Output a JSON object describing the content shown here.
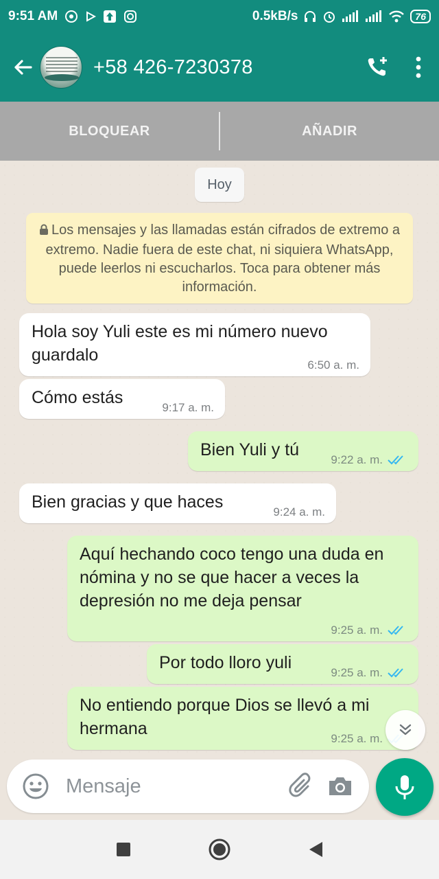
{
  "status_bar": {
    "time": "9:51 AM",
    "speed": "0.5kB/s",
    "battery": "76"
  },
  "header": {
    "contact": "+58 426-7230378",
    "icons": [
      "back-arrow-icon",
      "add-call-icon",
      "more-vert-icon"
    ],
    "color": "#128c7e"
  },
  "actions": {
    "block": "BLOQUEAR",
    "add": "AÑADIR"
  },
  "chat": {
    "date_chip": "Hoy",
    "encryption_notice": "Los mensajes y las llamadas están cifrados de extremo a extremo. Nadie fuera de este chat, ni siquiera WhatsApp, puede leerlos ni escucharlos. Toca para obtener más información.",
    "messages": [
      {
        "direction": "in",
        "text": "Hola soy Yuli este es mi número nuevo guardalo",
        "time": "6:50 a. m."
      },
      {
        "direction": "in",
        "text": "Cómo estás",
        "time": "9:17 a. m."
      },
      {
        "direction": "out",
        "text": "Bien Yuli y tú",
        "time": "9:22 a. m.",
        "read": true
      },
      {
        "direction": "in",
        "text": "Bien gracias y que haces",
        "time": "9:24 a. m."
      },
      {
        "direction": "out",
        "text": "Aquí hechando coco tengo una duda en nómina y no se que hacer a veces la depresión no me deja pensar",
        "time": "9:25 a. m.",
        "read": true
      },
      {
        "direction": "out",
        "text": "Por todo lloro yuli",
        "time": "9:25 a. m.",
        "read": true
      },
      {
        "direction": "out",
        "text": "No entiendo porque Dios se llevó a mi hermana",
        "time": "9:25 a. m.",
        "read": true
      }
    ]
  },
  "composer": {
    "placeholder": "Mensaje"
  },
  "colors": {
    "outgoing_bubble": "#dcf8c6",
    "incoming_bubble": "#ffffff",
    "read_ticks": "#34b7f1",
    "mic_button": "#00a884"
  }
}
